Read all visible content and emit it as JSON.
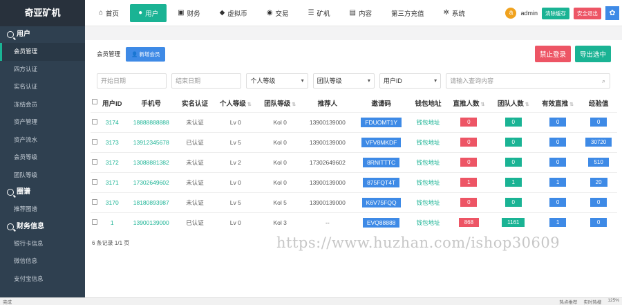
{
  "app": {
    "title": "奇亚矿机"
  },
  "sidebar": {
    "sections": [
      {
        "label": "用户",
        "items": [
          "会员管理",
          "四方认证",
          "实名认证",
          "冻结会员",
          "资产管理",
          "资产流水",
          "会员等级",
          "团队等级"
        ]
      },
      {
        "label": "圈谱",
        "items": [
          "推荐图谱"
        ]
      },
      {
        "label": "财务信息",
        "items": [
          "银行卡信息",
          "微信信息",
          "支付宝信息"
        ]
      }
    ],
    "active_item": "会员管理"
  },
  "topnav": {
    "items": [
      {
        "label": "首页",
        "icon": "home-icon",
        "glyph": "⌂"
      },
      {
        "label": "用户",
        "icon": "user-icon",
        "glyph": "●",
        "active": true
      },
      {
        "label": "财务",
        "icon": "finance-icon",
        "glyph": "▣"
      },
      {
        "label": "虚拟币",
        "icon": "coin-icon",
        "glyph": "◆"
      },
      {
        "label": "交易",
        "icon": "trade-icon",
        "glyph": "◉"
      },
      {
        "label": "矿机",
        "icon": "miner-icon",
        "glyph": "☰"
      },
      {
        "label": "内容",
        "icon": "content-icon",
        "glyph": "▤"
      },
      {
        "label": "第三方充值",
        "icon": "",
        "glyph": ""
      },
      {
        "label": "系统",
        "icon": "gear-icon",
        "glyph": "✲"
      }
    ],
    "avatar_letter": "a",
    "admin": "admin",
    "clear_cache": "清除缓存",
    "logout": "安全退出"
  },
  "page": {
    "title": "会员管理",
    "add_button": "新增会员",
    "ban_login": "禁止登录",
    "export": "导出选中"
  },
  "filters": {
    "start_date": "开始日期",
    "end_date": "结束日期",
    "personal_level": "个人等级",
    "team_level": "团队等级",
    "user_id": "用户ID",
    "query_placeholder": "请输入查询内容"
  },
  "table": {
    "headers": [
      "用户ID",
      "手机号",
      "实名认证",
      "个人等级",
      "团队等级",
      "推荐人",
      "邀请码",
      "钱包地址",
      "直推人数",
      "团队人数",
      "有效直推",
      "经验值"
    ],
    "rows": [
      {
        "id": "3174",
        "phone": "18888888888",
        "auth": "未认证",
        "plevel": "Lv 0",
        "tlevel": "Kol 0",
        "ref": "13900139000",
        "code": "FDUOMT1Y",
        "wallet": "钱包地址",
        "direct": "0",
        "team": "0",
        "valid": "0",
        "exp": "0"
      },
      {
        "id": "3173",
        "phone": "13912345678",
        "auth": "已认证",
        "plevel": "Lv 5",
        "tlevel": "Kol 0",
        "ref": "13900139000",
        "code": "VFV8MKDF",
        "wallet": "钱包地址",
        "direct": "0",
        "team": "0",
        "valid": "0",
        "exp": "30720"
      },
      {
        "id": "3172",
        "phone": "13088881382",
        "auth": "未认证",
        "plevel": "Lv 2",
        "tlevel": "Kol 0",
        "ref": "17302649602",
        "code": "8RNITTTC",
        "wallet": "钱包地址",
        "direct": "0",
        "team": "0",
        "valid": "0",
        "exp": "510"
      },
      {
        "id": "3171",
        "phone": "17302649602",
        "auth": "未认证",
        "plevel": "Lv 0",
        "tlevel": "Kol 0",
        "ref": "13900139000",
        "code": "875FQT4T",
        "wallet": "钱包地址",
        "direct": "1",
        "team": "1",
        "valid": "1",
        "exp": "20"
      },
      {
        "id": "3170",
        "phone": "18180893987",
        "auth": "未认证",
        "plevel": "Lv 5",
        "tlevel": "Kol 5",
        "ref": "13900139000",
        "code": "K6V75FQQ",
        "wallet": "钱包地址",
        "direct": "0",
        "team": "0",
        "valid": "0",
        "exp": "0"
      },
      {
        "id": "1",
        "phone": "13900139000",
        "auth": "已认证",
        "plevel": "Lv 0",
        "tlevel": "Kol 3",
        "ref": "--",
        "code": "EVQ88888",
        "wallet": "钱包地址",
        "direct": "868",
        "team": "1161",
        "valid": "1",
        "exp": "0"
      }
    ]
  },
  "footer": {
    "summary": "6 条记录 1/1 页"
  },
  "watermark": "https://www.huzhan.com/ishop30609",
  "statusbar": {
    "left": "完成",
    "hot": "热点推荐",
    "live": "实时热搜",
    "zoom": "125%"
  }
}
